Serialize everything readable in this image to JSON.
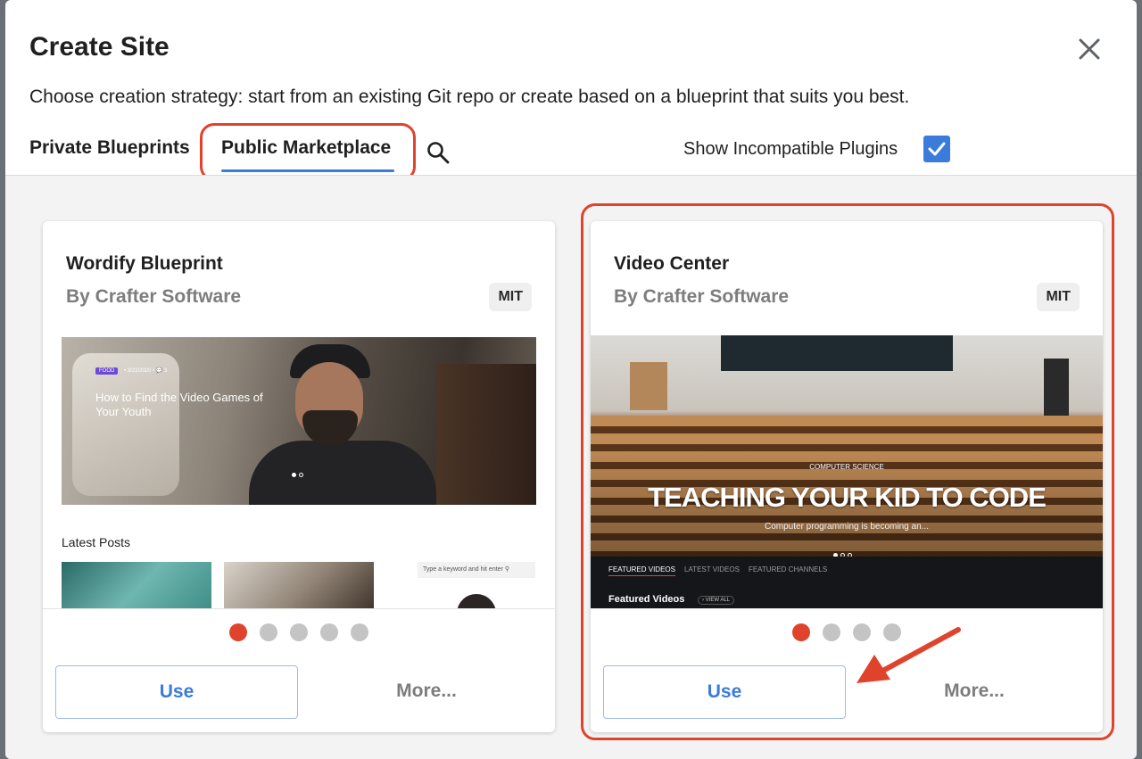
{
  "dialog": {
    "title": "Create Site",
    "subtitle": "Choose creation strategy: start from an existing Git repo or create based on a blueprint that suits you best."
  },
  "tabs": [
    {
      "label": "Private Blueprints",
      "active": false
    },
    {
      "label": "Public Marketplace",
      "active": true
    }
  ],
  "filters": {
    "show_incompatible_label": "Show Incompatible Plugins",
    "show_incompatible_checked": true
  },
  "icons": {
    "close": "close-icon",
    "search": "search-icon",
    "check": "check-icon"
  },
  "colors": {
    "accent": "#3a7bdb",
    "highlight": "#e0432c"
  },
  "cards": [
    {
      "title": "Wordify Blueprint",
      "author": "By Crafter Software",
      "license": "MIT",
      "slides": 5,
      "active_slide": 1,
      "use_label": "Use",
      "more_label": "More...",
      "preview": {
        "badge": "FOOD",
        "meta": "• 3/22/2020 • 💬 3",
        "headline": "How to Find the Video Games of Your Youth",
        "latest_posts": "Latest Posts",
        "search_placeholder": "Type a keyword and hit enter"
      }
    },
    {
      "title": "Video Center",
      "author": "By Crafter Software",
      "license": "MIT",
      "slides": 4,
      "active_slide": 1,
      "use_label": "Use",
      "more_label": "More...",
      "preview": {
        "category": "COMPUTER SCIENCE",
        "headline": "TEACHING YOUR KID TO CODE",
        "subheadline": "Computer programming is becoming an...",
        "nav": [
          "FEATURED VIDEOS",
          "LATEST VIDEOS",
          "FEATURED CHANNELS"
        ],
        "section_title": "Featured Videos",
        "view_all": "› VIEW ALL"
      }
    }
  ]
}
